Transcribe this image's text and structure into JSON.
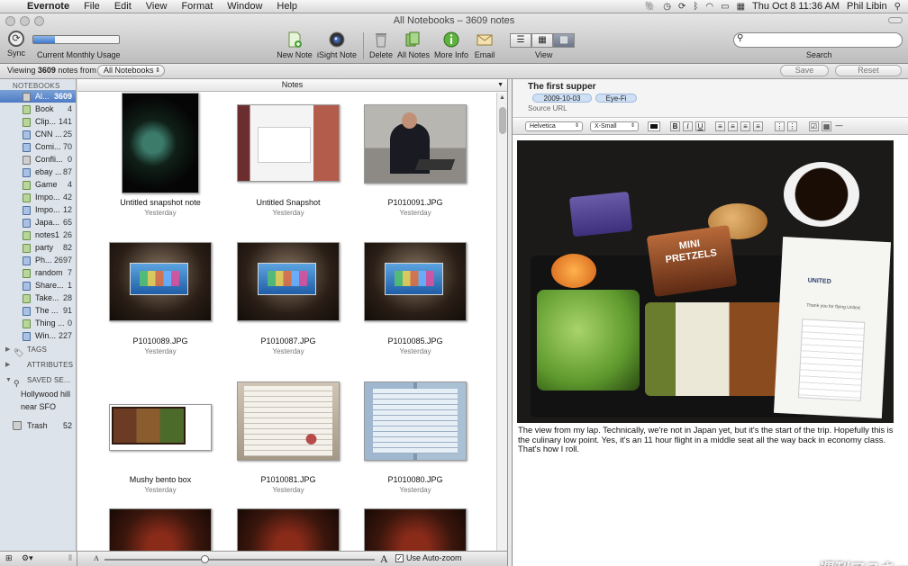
{
  "menubar": {
    "app": "Evernote",
    "menus": [
      "File",
      "Edit",
      "View",
      "Format",
      "Window",
      "Help"
    ],
    "clock": "Thu Oct 8  11:36 AM",
    "user": "Phil Libin"
  },
  "window": {
    "title": "All Notebooks – 3609 notes"
  },
  "toolbar": {
    "sync": "Sync",
    "usage_label": "Current Monthly Usage",
    "usage_level": 0.25,
    "new_note": "New Note",
    "isight_note": "iSight Note",
    "delete": "Delete",
    "all_notes": "All Notes",
    "more_info": "More Info",
    "email": "Email",
    "view": "View",
    "search_label": "Search",
    "search_value": ""
  },
  "subbar": {
    "viewing_prefix": "Viewing ",
    "viewing_count": "3609",
    "viewing_suffix": " notes from",
    "notebook_select": "All Notebooks",
    "save": "Save",
    "reset": "Reset"
  },
  "sidebar": {
    "header": "NOTEBOOKS",
    "notebooks": [
      {
        "name": "Al...",
        "count": "3609",
        "color": "gray"
      },
      {
        "name": "Book",
        "count": "4",
        "color": "green"
      },
      {
        "name": "Clip...",
        "count": "141",
        "color": "green"
      },
      {
        "name": "CNN ...",
        "count": "25",
        "color": "blue"
      },
      {
        "name": "Comi...",
        "count": "70",
        "color": "blue"
      },
      {
        "name": "Confli...",
        "count": "0",
        "color": "gray"
      },
      {
        "name": "ebay ...",
        "count": "87",
        "color": "blue"
      },
      {
        "name": "Game",
        "count": "4",
        "color": "green"
      },
      {
        "name": "Impo...",
        "count": "42",
        "color": "green"
      },
      {
        "name": "Impo...",
        "count": "12",
        "color": "blue"
      },
      {
        "name": "Japa...",
        "count": "65",
        "color": "blue"
      },
      {
        "name": "notes1",
        "count": "26",
        "color": "green"
      },
      {
        "name": "party",
        "count": "82",
        "color": "green"
      },
      {
        "name": "Ph...",
        "count": "2697",
        "color": "blue"
      },
      {
        "name": "random",
        "count": "7",
        "color": "green"
      },
      {
        "name": "Share...",
        "count": "1",
        "color": "blue"
      },
      {
        "name": "Take...",
        "count": "28",
        "color": "green"
      },
      {
        "name": "The ...",
        "count": "91",
        "color": "blue"
      },
      {
        "name": "Thing ...",
        "count": "0",
        "color": "green"
      },
      {
        "name": "Win...",
        "count": "227",
        "color": "blue"
      }
    ],
    "tags": "TAGS",
    "attributes": "ATTRIBUTES",
    "saved_searches": "SAVED SE...",
    "saved": [
      "Hollywood hill",
      "near SFO"
    ],
    "trash": "Trash",
    "trash_count": "52"
  },
  "notes_pane": {
    "header": "Notes",
    "items": [
      {
        "title": "Untitled snapshot note",
        "date": "Yesterday",
        "thumb": "dark"
      },
      {
        "title": "Untitled Snapshot",
        "date": "Yesterday",
        "thumb": "card"
      },
      {
        "title": "P1010091.JPG",
        "date": "Yesterday",
        "thumb": "man"
      },
      {
        "title": "P1010089.JPG",
        "date": "Yesterday",
        "thumb": "slide"
      },
      {
        "title": "P1010087.JPG",
        "date": "Yesterday",
        "thumb": "slide"
      },
      {
        "title": "P1010085.JPG",
        "date": "Yesterday",
        "thumb": "slide"
      },
      {
        "title": "Mushy bento box",
        "date": "Yesterday",
        "thumb": "bento"
      },
      {
        "title": "P1010081.JPG",
        "date": "Yesterday",
        "thumb": "doc"
      },
      {
        "title": "P1010080.JPG",
        "date": "Yesterday",
        "thumb": "brochure"
      },
      {
        "title": "",
        "date": "",
        "thumb": "food"
      },
      {
        "title": "",
        "date": "",
        "thumb": "food"
      },
      {
        "title": "",
        "date": "",
        "thumb": "food"
      }
    ],
    "auto_zoom": "Use Auto-zoom",
    "zoom_level": 0.37
  },
  "note": {
    "title": "The first supper",
    "tags": [
      "2009-10-03",
      "Eye-Fi"
    ],
    "source_url": "Source URL",
    "font": "Helvetica",
    "size": "X-Small",
    "body": "The view from my lap. Technically, we're not in Japan yet, but it's the start of the trip. Hopefully this is the culinary low point. Yes, it's an 11 hour flight in a middle seat all the way back in economy class. That's how I roll."
  },
  "photo_text": {
    "pretzels": "MINI\nPRETZELS",
    "napkin_brand": "UNITED",
    "napkin_msg": "Thank you for flying United.",
    "watermark": "週刊アスキー"
  }
}
